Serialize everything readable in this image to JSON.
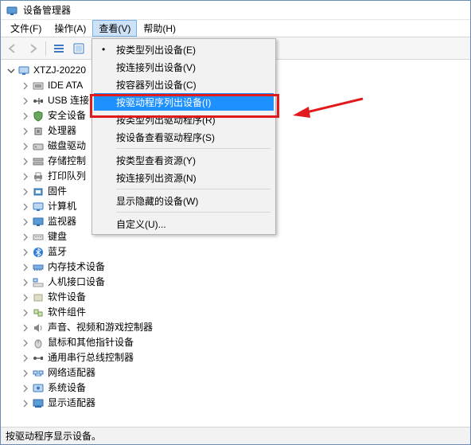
{
  "window": {
    "title": "设备管理器"
  },
  "menu": {
    "file": "文件(F)",
    "action": "操作(A)",
    "view": "查看(V)",
    "help": "帮助(H)"
  },
  "view_menu": {
    "by_type": "按类型列出设备(E)",
    "by_conn": "按连接列出设备(V)",
    "by_container": "按容器列出设备(C)",
    "by_driver": "按驱动程序列出设备(I)",
    "drv_by_type": "按类型列出驱动程序(R)",
    "drv_by_device": "按设备查看驱动程序(S)",
    "res_by_type": "按类型查看资源(Y)",
    "res_by_conn": "按连接列出资源(N)",
    "show_hidden": "显示隐藏的设备(W)",
    "customize": "自定义(U)..."
  },
  "tree": {
    "root": "XTZJ-20220",
    "items": [
      "IDE ATA",
      "USB 连接",
      "安全设备",
      "处理器",
      "磁盘驱动",
      "存储控制",
      "打印队列",
      "固件",
      "计算机",
      "监视器",
      "键盘",
      "蓝牙",
      "内存技术设备",
      "人机接口设备",
      "软件设备",
      "软件组件",
      "声音、视频和游戏控制器",
      "鼠标和其他指针设备",
      "通用串行总线控制器",
      "网络适配器",
      "系统设备",
      "显示适配器"
    ]
  },
  "status": "按驱动程序显示设备。"
}
